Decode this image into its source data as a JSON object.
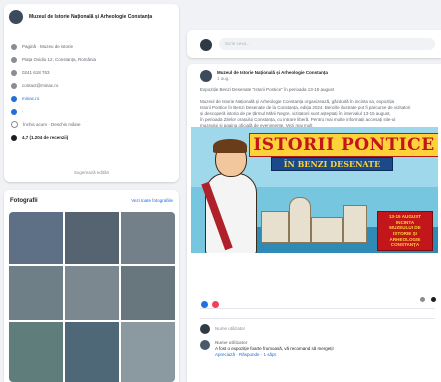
{
  "page": {
    "name": "Muzeul de Istorie Națională și Arheologie Constanța"
  },
  "about": {
    "items": [
      {
        "icon": "flag-icon",
        "text": "Pagină · Muzeu de istorie"
      },
      {
        "icon": "location-icon",
        "text": "Piața Ovidiu 12, Constanța, România"
      },
      {
        "icon": "phone-icon",
        "text": "0241 618 763"
      },
      {
        "icon": "email-icon",
        "text": "contact@minac.ro"
      },
      {
        "icon": "website-icon",
        "text": "minac.ro"
      },
      {
        "icon": "info-icon",
        "text": "·"
      },
      {
        "icon": "clock-icon",
        "text": "Închis acum · Deschis mâine"
      },
      {
        "icon": "rating-icon",
        "text": "4,7 (1.204 de recenzii)"
      }
    ],
    "see_more": "Sugerează editări"
  },
  "photos": {
    "heading": "Fotografii",
    "see_all": "Vezi toate fotografiile",
    "items": [
      "Fotografie 1",
      "Fotografie 2",
      "Fotografie 3",
      "Fotografie 4",
      "Fotografie 5",
      "Fotografie 6",
      "Fotografie 7",
      "Fotografie 8",
      "Fotografie 9"
    ]
  },
  "composer": {
    "placeholder": "Scrie ceva..."
  },
  "post": {
    "author": "Muzeul de Istorie Națională și Arheologie Constanța",
    "time": "1 aug. ·",
    "intro": "Expoziție Benzi Desenate \"Istorii Pontice\" în perioada 13-15 august",
    "body": [
      "Muzeul de Istorie Națională și Arheologie Constanța organizează, găzduită în incinta sa, expoziția",
      "Istorii Pontice în Benzi Desenate de la Constanța, ediția 2024. Benzile ilustrate pot fi parcurse de vizitatori",
      "și descoperă istoria de pe țărmul Mării Negre, vizitatorii sunt așteptați în intervalul 13-15 august,",
      "în perioada Zilelor orașului Constanța, cu intrare liberă. Pentru mai multe informații accesați site-ul",
      "muzeului și pagina oficială de evenimente. Vezi mai mult"
    ],
    "poster": {
      "title": "ISTORII PONTICE",
      "subtitle": "ÎN BENZI DESENATE",
      "info_lines": [
        "13-15 AUGUST",
        "INCINTA",
        "MUZEULUI DE",
        "ISTORIE ȘI",
        "ARHEOLOGIE",
        "CONSTANȚA"
      ]
    },
    "reactions_count": "",
    "comments_count": "",
    "shares_count": ""
  },
  "comments": [
    {
      "author": "Nume utilizator",
      "text": "",
      "meta": ""
    },
    {
      "author": "Nume utilizator",
      "text": "A fost o expoziție foarte frumoasă, vă recomand să mergeți!",
      "meta": "Apreciază · Răspunde · 1 săpt."
    }
  ],
  "colors": {
    "page_bg": "#f0f2f5",
    "accent": "#216fdb",
    "poster_title": "#c2161b",
    "poster_yellow": "#ffd23a"
  }
}
